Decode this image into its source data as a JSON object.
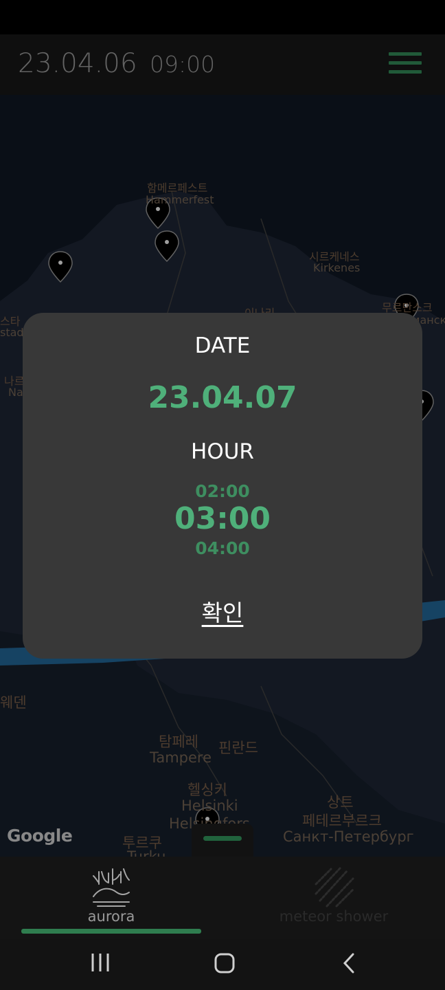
{
  "header": {
    "date": "23.04.06",
    "time": "09:00"
  },
  "map": {
    "labels": [
      {
        "text": "함메르페스트"
      },
      {
        "text": "Hammerfest"
      },
      {
        "text": "시르케네스"
      },
      {
        "text": "Kirkenes"
      },
      {
        "text": "무르만스크"
      },
      {
        "text": "Мурманск"
      },
      {
        "text": "이나리"
      },
      {
        "text": "스타"
      },
      {
        "text": "stad"
      },
      {
        "text": "나르"
      },
      {
        "text": "Na"
      },
      {
        "text": "웨덴"
      },
      {
        "text": "탐페레"
      },
      {
        "text": "Tampere"
      },
      {
        "text": "핀란드"
      },
      {
        "text": "헬싱키"
      },
      {
        "text": "Helsinki"
      },
      {
        "text": "Helsingfors"
      },
      {
        "text": "상트"
      },
      {
        "text": "페테르부르크"
      },
      {
        "text": "Санкт-Петербург"
      },
      {
        "text": "투르쿠"
      },
      {
        "text": "Turku"
      }
    ],
    "attribution": "Google"
  },
  "dialog": {
    "date_label": "DATE",
    "date_value": "23.04.07",
    "hour_label": "HOUR",
    "hour_prev": "02:00",
    "hour_selected": "03:00",
    "hour_next": "04:00",
    "confirm_label": "확인"
  },
  "bottom_nav": {
    "tabs": [
      {
        "label": "aurora",
        "icon": "aurora-icon",
        "active": true
      },
      {
        "label": "meteor shower",
        "icon": "meteor-shower-icon",
        "active": false
      }
    ]
  },
  "colors": {
    "accent": "#4fb07a",
    "accent_dark": "#2f7d4f",
    "dialog_bg": "#383838"
  }
}
